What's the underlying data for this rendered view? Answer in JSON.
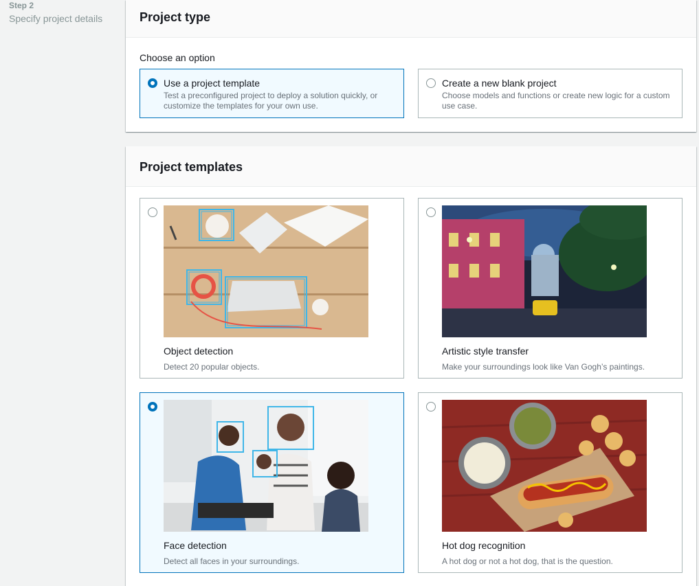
{
  "sidebar": {
    "step_label": "Step 2",
    "step_name": "Specify project details"
  },
  "project_type": {
    "title": "Project type",
    "choose_label": "Choose an option",
    "options": [
      {
        "title": "Use a project template",
        "description": "Test a preconfigured project to deploy a solution quickly, or customize the templates for your own use.",
        "selected": true
      },
      {
        "title": "Create a new blank project",
        "description": "Choose models and functions or create new logic for a custom use case.",
        "selected": false
      }
    ]
  },
  "templates": {
    "title": "Project templates",
    "items": [
      {
        "title": "Object detection",
        "description": "Detect 20 popular objects.",
        "selected": false
      },
      {
        "title": "Artistic style transfer",
        "description": "Make your surroundings look like Van Gogh’s paintings.",
        "selected": false
      },
      {
        "title": "Face detection",
        "description": "Detect all faces in your surroundings.",
        "selected": true
      },
      {
        "title": "Hot dog recognition",
        "description": "A hot dog or not a hot dog, that is the question.",
        "selected": false
      }
    ]
  },
  "colors": {
    "accent": "#0073bb",
    "selected_bg": "#f1faff",
    "border": "#aab7b8"
  }
}
